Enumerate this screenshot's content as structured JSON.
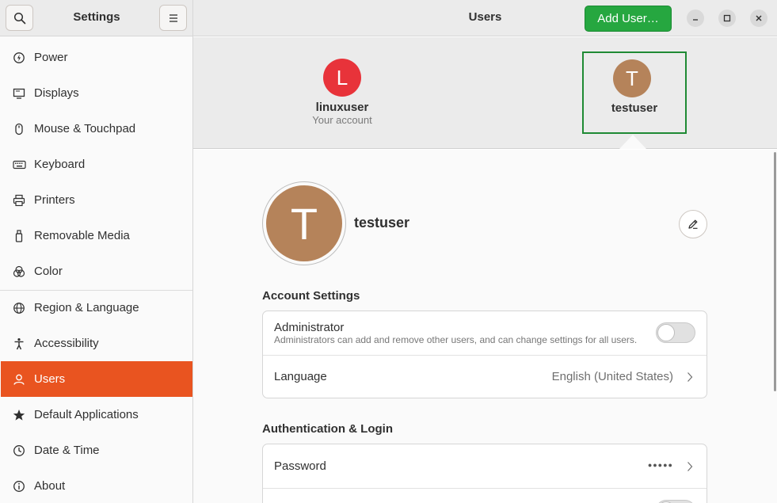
{
  "sidebar": {
    "title": "Settings",
    "items": [
      {
        "label": "Power",
        "icon": "power-icon"
      },
      {
        "label": "Displays",
        "icon": "display-icon"
      },
      {
        "label": "Mouse & Touchpad",
        "icon": "mouse-icon"
      },
      {
        "label": "Keyboard",
        "icon": "keyboard-icon"
      },
      {
        "label": "Printers",
        "icon": "printer-icon"
      },
      {
        "label": "Removable Media",
        "icon": "usb-drive-icon"
      },
      {
        "label": "Color",
        "icon": "color-icon"
      },
      {
        "label": "Region & Language",
        "icon": "globe-icon"
      },
      {
        "label": "Accessibility",
        "icon": "accessibility-icon"
      },
      {
        "label": "Users",
        "icon": "user-icon",
        "active": true
      },
      {
        "label": "Default Applications",
        "icon": "star-icon"
      },
      {
        "label": "Date & Time",
        "icon": "clock-icon"
      },
      {
        "label": "About",
        "icon": "info-icon"
      }
    ]
  },
  "header": {
    "title": "Users",
    "add_user_label": "Add User…"
  },
  "users": [
    {
      "initial": "L",
      "name": "linuxuser",
      "subtitle": "Your account",
      "color": "#e8333a"
    },
    {
      "initial": "T",
      "name": "testuser",
      "subtitle": "",
      "color": "#b5835a",
      "selected": true
    }
  ],
  "selected_user": {
    "initial": "T",
    "name": "testuser",
    "color": "#b5835a"
  },
  "account_settings": {
    "title": "Account Settings",
    "administrator": {
      "label": "Administrator",
      "description": "Administrators can add and remove other users, and can change settings for all users.",
      "enabled": false
    },
    "language": {
      "label": "Language",
      "value": "English (United States)"
    }
  },
  "auth": {
    "title": "Authentication & Login",
    "password": {
      "label": "Password",
      "value": "●●●●●"
    }
  },
  "colors": {
    "accent": "#e95420",
    "add_button": "#26a740",
    "selection_border": "#1f8a34"
  }
}
